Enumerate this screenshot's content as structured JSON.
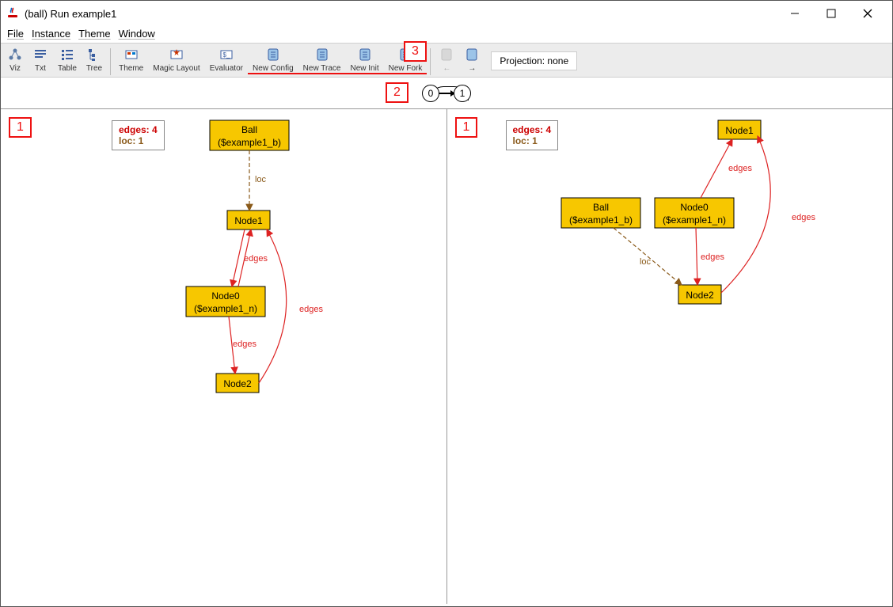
{
  "window": {
    "title": "(ball) Run example1"
  },
  "menubar": {
    "file": "File",
    "instance": "Instance",
    "theme": "Theme",
    "window": "Window"
  },
  "toolbar": {
    "viz": "Viz",
    "txt": "Txt",
    "table": "Table",
    "tree": "Tree",
    "theme": "Theme",
    "magic_layout": "Magic Layout",
    "evaluator": "Evaluator",
    "new_config": "New Config",
    "new_trace": "New Trace",
    "new_init": "New Init",
    "new_fork": "New Fork",
    "nav_prev": "←",
    "nav_next": "→"
  },
  "projection": "Projection: none",
  "states": {
    "s0": "0",
    "s1": "1"
  },
  "callouts": {
    "one": "1",
    "two": "2",
    "three": "3"
  },
  "panes": [
    {
      "info": {
        "edges": "edges: 4",
        "loc": "loc: 1"
      },
      "nodes": {
        "ball": {
          "line1": "Ball",
          "line2": "($example1_b)"
        },
        "node1": "Node1",
        "node0": {
          "line1": "Node0",
          "line2": "($example1_n)"
        },
        "node2": "Node2"
      },
      "edges": {
        "loc": "loc",
        "e1": "edges",
        "e2": "edges",
        "e3": "edges"
      }
    },
    {
      "info": {
        "edges": "edges: 4",
        "loc": "loc: 1"
      },
      "nodes": {
        "ball": {
          "line1": "Ball",
          "line2": "($example1_b)"
        },
        "node1": "Node1",
        "node0": {
          "line1": "Node0",
          "line2": "($example1_n)"
        },
        "node2": "Node2"
      },
      "edges": {
        "loc": "loc",
        "e1": "edges",
        "e2": "edges",
        "e3": "edges"
      }
    }
  ]
}
